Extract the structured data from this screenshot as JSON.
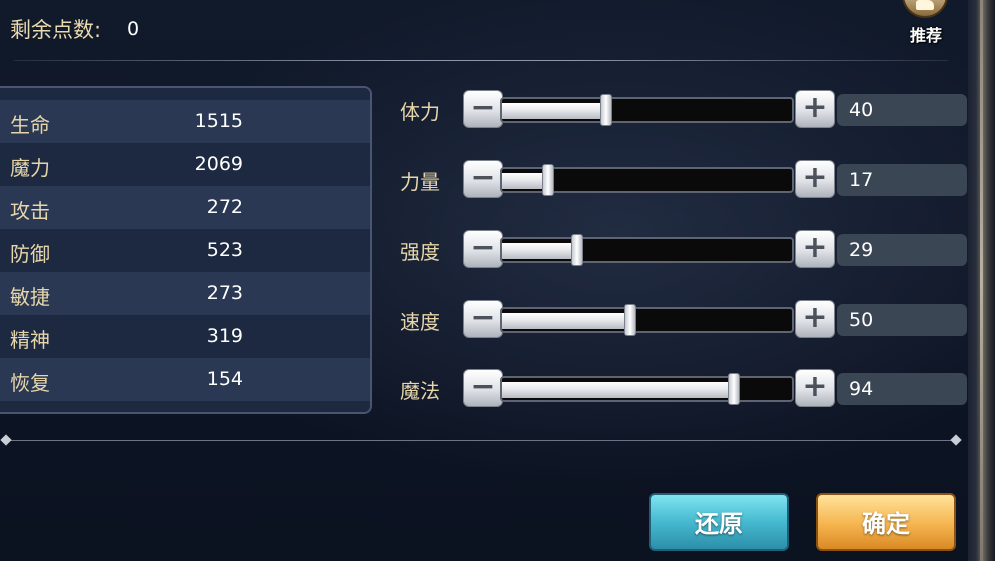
{
  "header": {
    "points_label": "剩余点数:",
    "points_value": "0",
    "recommend_label": "推荐"
  },
  "stats": [
    {
      "name": "生命",
      "value": "1515"
    },
    {
      "name": "魔力",
      "value": "2069"
    },
    {
      "name": "攻击",
      "value": "272"
    },
    {
      "name": "防御",
      "value": "523"
    },
    {
      "name": "敏捷",
      "value": "273"
    },
    {
      "name": "精神",
      "value": "319"
    },
    {
      "name": "恢复",
      "value": "154"
    }
  ],
  "attributes": [
    {
      "name": "体力",
      "value": "40",
      "slider_fraction": 0.36
    },
    {
      "name": "力量",
      "value": "17",
      "slider_fraction": 0.16
    },
    {
      "name": "强度",
      "value": "29",
      "slider_fraction": 0.26
    },
    {
      "name": "速度",
      "value": "50",
      "slider_fraction": 0.44
    },
    {
      "name": "魔法",
      "value": "94",
      "slider_fraction": 0.8
    }
  ],
  "controls": {
    "minus_symbol": "−",
    "plus_symbol": "+"
  },
  "buttons": {
    "restore_label": "还原",
    "confirm_label": "确定"
  },
  "colors": {
    "label_gold": "#e6d6aa",
    "restore_teal": "#45b9cf",
    "confirm_orange": "#f5b44e"
  }
}
